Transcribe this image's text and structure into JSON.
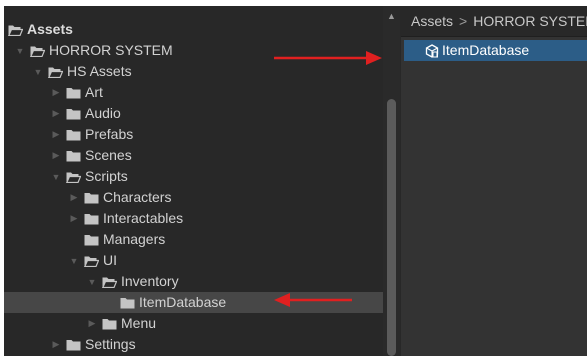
{
  "tree": {
    "rows": [
      {
        "label": "Assets",
        "depth": 0,
        "arrow": "",
        "open": true,
        "bold": true
      },
      {
        "label": "HORROR SYSTEM",
        "depth": 1,
        "arrow": "▼",
        "open": true
      },
      {
        "label": "HS Assets",
        "depth": 2,
        "arrow": "▼",
        "open": true
      },
      {
        "label": "Art",
        "depth": 3,
        "arrow": "▶",
        "open": false
      },
      {
        "label": "Audio",
        "depth": 3,
        "arrow": "▶",
        "open": false
      },
      {
        "label": "Prefabs",
        "depth": 3,
        "arrow": "▶",
        "open": false
      },
      {
        "label": "Scenes",
        "depth": 3,
        "arrow": "▶",
        "open": false
      },
      {
        "label": "Scripts",
        "depth": 3,
        "arrow": "▼",
        "open": true
      },
      {
        "label": "Characters",
        "depth": 4,
        "arrow": "▶",
        "open": false
      },
      {
        "label": "Interactables",
        "depth": 4,
        "arrow": "▶",
        "open": false
      },
      {
        "label": "Managers",
        "depth": 4,
        "arrow": "",
        "open": false
      },
      {
        "label": "UI",
        "depth": 4,
        "arrow": "▼",
        "open": true
      },
      {
        "label": "Inventory",
        "depth": 5,
        "arrow": "▼",
        "open": true
      },
      {
        "label": "ItemDatabase",
        "depth": 6,
        "arrow": "",
        "open": false,
        "selected": true
      },
      {
        "label": "Menu",
        "depth": 5,
        "arrow": "▶",
        "open": false
      },
      {
        "label": "Settings",
        "depth": 3,
        "arrow": "▶",
        "open": false
      }
    ]
  },
  "breadcrumb": {
    "first": "Assets",
    "separator": ">",
    "second": "HORROR SYSTEM"
  },
  "content": {
    "item_label": "ItemDatabase",
    "item_icon": "scriptable-object-icon"
  },
  "colors": {
    "background": "#282828",
    "selected_row": "#474747",
    "selected_item": "#2c5d87",
    "annotation_arrow": "#e02020",
    "folder": "#c4c4c4"
  }
}
